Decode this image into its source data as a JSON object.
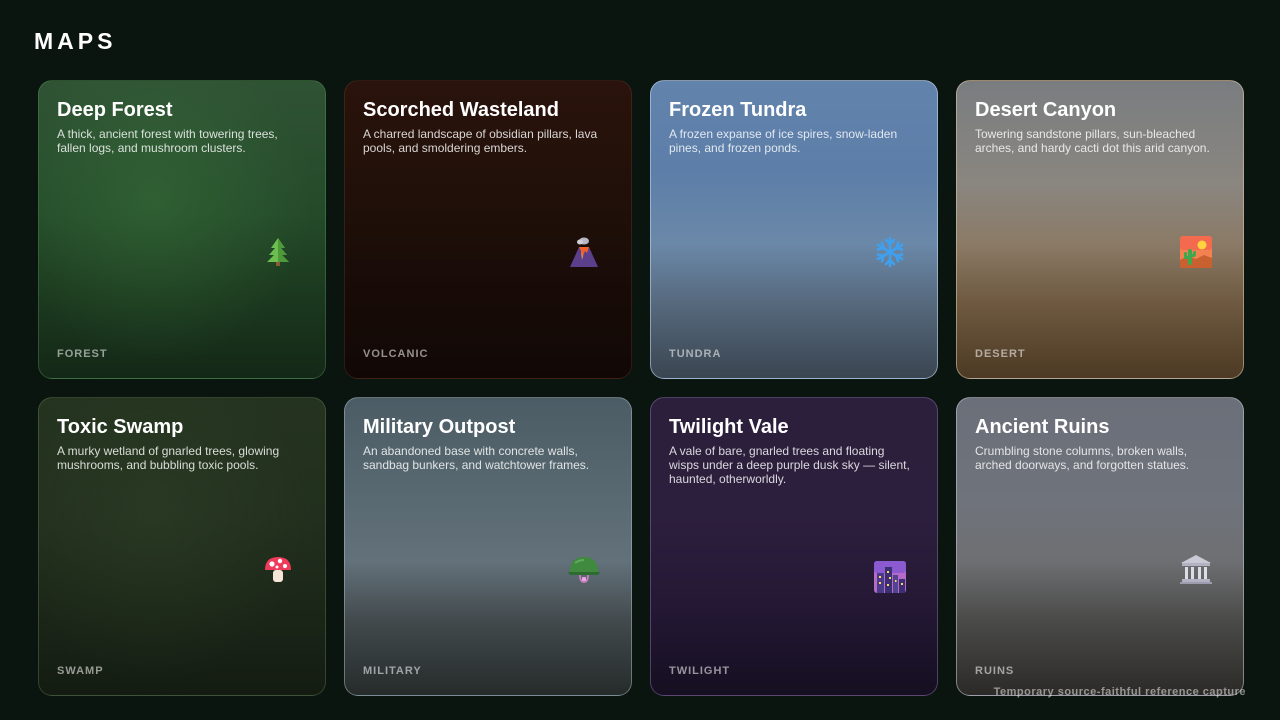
{
  "header": {
    "title": "MAPS"
  },
  "maps": [
    {
      "title": "Deep Forest",
      "description": "A thick, ancient forest with towering trees, fallen logs, and mushroom clusters.",
      "tag": "FOREST",
      "icon": "evergreen-tree-icon"
    },
    {
      "title": "Scorched Wasteland",
      "description": "A charred landscape of obsidian pillars, lava pools, and smoldering embers.",
      "tag": "VOLCANIC",
      "icon": "volcano-icon"
    },
    {
      "title": "Frozen Tundra",
      "description": "A frozen expanse of ice spires, snow-laden pines, and frozen ponds.",
      "tag": "TUNDRA",
      "icon": "snowflake-icon"
    },
    {
      "title": "Desert Canyon",
      "description": "Towering sandstone pillars, sun-bleached arches, and hardy cacti dot this arid canyon.",
      "tag": "DESERT",
      "icon": "desert-icon"
    },
    {
      "title": "Toxic Swamp",
      "description": "A murky wetland of gnarled trees, glowing mushrooms, and bubbling toxic pools.",
      "tag": "SWAMP",
      "icon": "mushroom-icon"
    },
    {
      "title": "Military Outpost",
      "description": "An abandoned base with concrete walls, sandbag bunkers, and watchtower frames.",
      "tag": "MILITARY",
      "icon": "military-helmet-icon"
    },
    {
      "title": "Twilight Vale",
      "description": "A vale of bare, gnarled trees and floating wisps under a deep purple dusk sky — silent, haunted, otherworldly.",
      "tag": "TWILIGHT",
      "icon": "night-city-icon"
    },
    {
      "title": "Ancient Ruins",
      "description": "Crumbling stone columns, broken walls, arched doorways, and forgotten statues.",
      "tag": "RUINS",
      "icon": "classical-building-icon"
    }
  ],
  "footer": {
    "note": "Temporary source-faithful reference capture"
  }
}
